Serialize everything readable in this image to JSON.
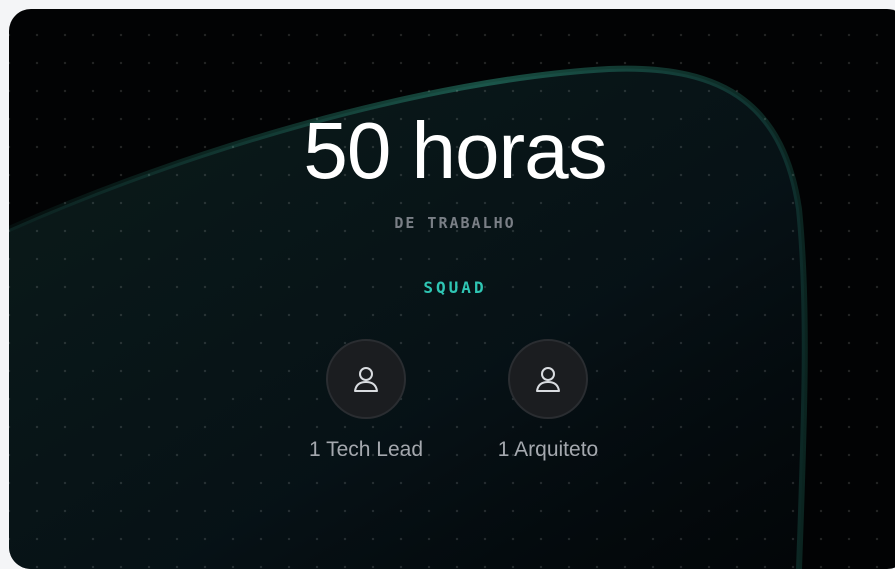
{
  "hours": {
    "value": "50 horas",
    "subtitle": "DE TRABALHO"
  },
  "squad": {
    "title": "SQUAD",
    "members": [
      {
        "label": "1 Tech Lead",
        "icon": "user-icon"
      },
      {
        "label": "1 Arquiteto",
        "icon": "user-icon"
      }
    ]
  },
  "colors": {
    "background": "#020304",
    "accent": "#2fc6b4",
    "glow": "#1f6f5f"
  }
}
